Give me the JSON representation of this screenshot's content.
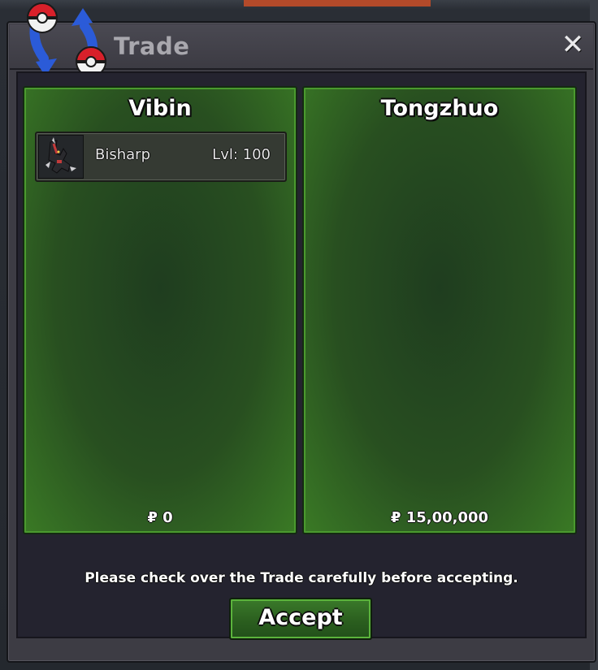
{
  "window": {
    "title": "Trade",
    "close_label": "✕"
  },
  "trade": {
    "left": {
      "trainer": "Vibin",
      "items": [
        {
          "name": "Bisharp",
          "level": "Lvl: 100",
          "icon": "bisharp-sprite-icon"
        }
      ],
      "money": "₽ 0"
    },
    "right": {
      "trainer": "Tongzhuo",
      "items": [],
      "money": "₽ 15,00,000"
    }
  },
  "notice": "Please check over the Trade carefully before accepting.",
  "accept_label": "Accept",
  "colors": {
    "panel_green": "#2f6122",
    "panel_border": "#4a9a2e",
    "window_bg": "#3d3c44",
    "content_bg": "#24232f",
    "title_text": "#a9a8ae"
  }
}
